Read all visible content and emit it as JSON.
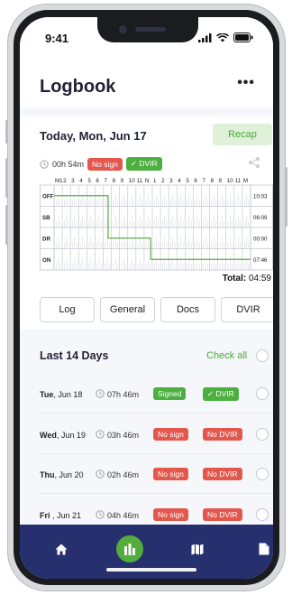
{
  "status": {
    "time": "9:41"
  },
  "header": {
    "title": "Logbook",
    "more_label": "•••"
  },
  "today": {
    "title": "Today, Mon, Jun 17",
    "recap_label": "Recap",
    "duration": "00h 54m",
    "sign_badge": "No sign",
    "dvir_badge": "✓ DVIR",
    "hours_label": [
      "M1",
      "2",
      "3",
      "4",
      "5",
      "6",
      "7",
      "8",
      "9",
      "10",
      "11",
      "N",
      "1",
      "2",
      "3",
      "4",
      "5",
      "6",
      "7",
      "8",
      "9",
      "10",
      "11",
      "M"
    ],
    "rows": [
      {
        "label": "OFF",
        "total": "10:03"
      },
      {
        "label": "SB",
        "total": "06:09"
      },
      {
        "label": "DR",
        "total": "00:00"
      },
      {
        "label": "ON",
        "total": "07:46"
      }
    ],
    "total_label": "Total:",
    "total_value": "04:59"
  },
  "tabs": [
    "Log",
    "General",
    "Docs",
    "DVIR"
  ],
  "history": {
    "title": "Last 14 Days",
    "check_all_label": "Check all",
    "days": [
      {
        "day": "Tue",
        "date": ", Jun 18",
        "duration": "07h 46m",
        "sign": "Signed",
        "sign_color": "green",
        "dvir": "✓ DVIR",
        "dvir_color": "green"
      },
      {
        "day": "Wed",
        "date": ", Jun 19",
        "duration": "03h 46m",
        "sign": "No sign",
        "sign_color": "red",
        "dvir": "No DVIR",
        "dvir_color": "red"
      },
      {
        "day": "Thu",
        "date": ", Jun 20",
        "duration": "02h 46m",
        "sign": "No sign",
        "sign_color": "red",
        "dvir": "No DVIR",
        "dvir_color": "red"
      },
      {
        "day": "Fri",
        "date": " , Jun 21",
        "duration": "04h 46m",
        "sign": "No sign",
        "sign_color": "red",
        "dvir": "No DVIR",
        "dvir_color": "red"
      }
    ]
  },
  "nav": {
    "items": [
      "home-icon",
      "chart-icon",
      "map-icon",
      "document-icon"
    ],
    "active": "chart-icon",
    "color": "#27306e",
    "accent": "#53ad3c"
  }
}
